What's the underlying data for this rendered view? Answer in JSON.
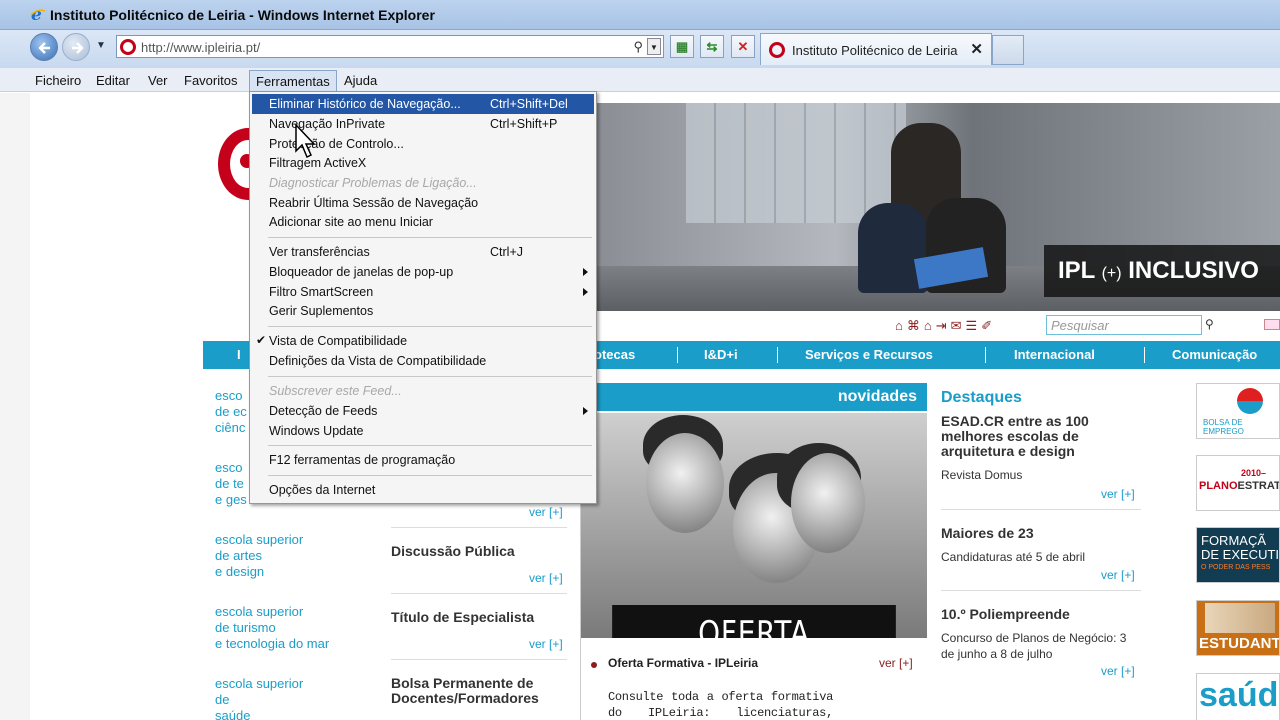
{
  "window": {
    "title": "Instituto Politécnico de Leiria - Windows Internet Explorer"
  },
  "address": {
    "url": "http://www.ipleiria.pt/"
  },
  "tab": {
    "label": "Instituto Politécnico de Leiria",
    "close": "✕"
  },
  "menubar": [
    "Ficheiro",
    "Editar",
    "Ver",
    "Favoritos",
    "Ferramentas",
    "Ajuda"
  ],
  "tools_menu": [
    {
      "label": "Eliminar Histórico de Navegação...",
      "shortcut": "Ctrl+Shift+Del"
    },
    {
      "label": "Navegação InPrivate",
      "shortcut": "Ctrl+Shift+P"
    },
    {
      "label": "Protecção de Controlo...",
      "shortcut": ""
    },
    {
      "label": "Filtragem ActiveX",
      "shortcut": ""
    },
    {
      "label": "Diagnosticar Problemas de Ligação...",
      "shortcut": ""
    },
    {
      "label": "Reabrir Última Sessão de Navegação",
      "shortcut": ""
    },
    {
      "label": "Adicionar site ao menu Iniciar",
      "shortcut": ""
    },
    {
      "label": "Ver transferências",
      "shortcut": "Ctrl+J"
    },
    {
      "label": "Bloqueador de janelas de pop-up",
      "shortcut": ""
    },
    {
      "label": "Filtro SmartScreen",
      "shortcut": ""
    },
    {
      "label": "Gerir Suplementos",
      "shortcut": ""
    },
    {
      "label": "Vista de Compatibilidade",
      "shortcut": ""
    },
    {
      "label": "Definições da Vista de Compatibilidade",
      "shortcut": ""
    },
    {
      "label": "Subscrever este Feed...",
      "shortcut": ""
    },
    {
      "label": "Detecção de Feeds",
      "shortcut": ""
    },
    {
      "label": "Windows Update",
      "shortcut": ""
    },
    {
      "label": "F12 ferramentas de programação",
      "shortcut": ""
    },
    {
      "label": "Opções da Internet",
      "shortcut": ""
    }
  ],
  "banner": {
    "slogan_a": "IPL",
    "slogan_plus": "(+)",
    "slogan_b": "INCLUSIVO"
  },
  "search": {
    "placeholder": "Pesquisar"
  },
  "nav": [
    "I",
    "otecas",
    "I&D+i",
    "Serviços e Recursos",
    "Internacional",
    "Comunicação"
  ],
  "schools": [
    "esco\nde ec\nciênc",
    "esco\nde te\ne ges",
    "escola superior\nde artes\ne design",
    "escola superior\nde turismo\ne tecnologia do mar",
    "escola superior\nde\nsaúde"
  ],
  "col2": {
    "items": [
      "Discussão Pública",
      "Título de Especialista",
      "Bolsa Permanente de\nDocentes/Formadores"
    ],
    "ver": "ver [+]"
  },
  "feature": {
    "head": "novidades",
    "image_text": "OFERTA FORMATIVA",
    "title": "Oferta Formativa - IPLeiria",
    "ver": "ver [+]",
    "desc": "Consulte toda a oferta formativa do IPLeiria: licenciaturas, mestrados, pós-"
  },
  "destaques": {
    "title": "Destaques",
    "items": [
      {
        "head": "ESAD.CR entre as 100\nmelhores escolas de\narquitetura e design",
        "desc": "Revista Domus"
      },
      {
        "head": "Maiores de 23",
        "desc": "Candidaturas até 5 de abril"
      },
      {
        "head": "10.º Poliempreende",
        "desc": "Concurso de Planos de Negócio: 3\nde junho a 8 de julho"
      }
    ],
    "ver": "ver [+]"
  },
  "ads": {
    "a1": "BOLSA DE EMPREGO",
    "a2_year": "2010–",
    "a2_main": "PLANO",
    "a2_rest": "ESTRATÉG",
    "a3_title": "FORMAÇÃ\nDE EXECUTIV",
    "a3_sub": "O PODER DAS PESS",
    "a4": "ESTUDANT",
    "a5": "saúde"
  }
}
